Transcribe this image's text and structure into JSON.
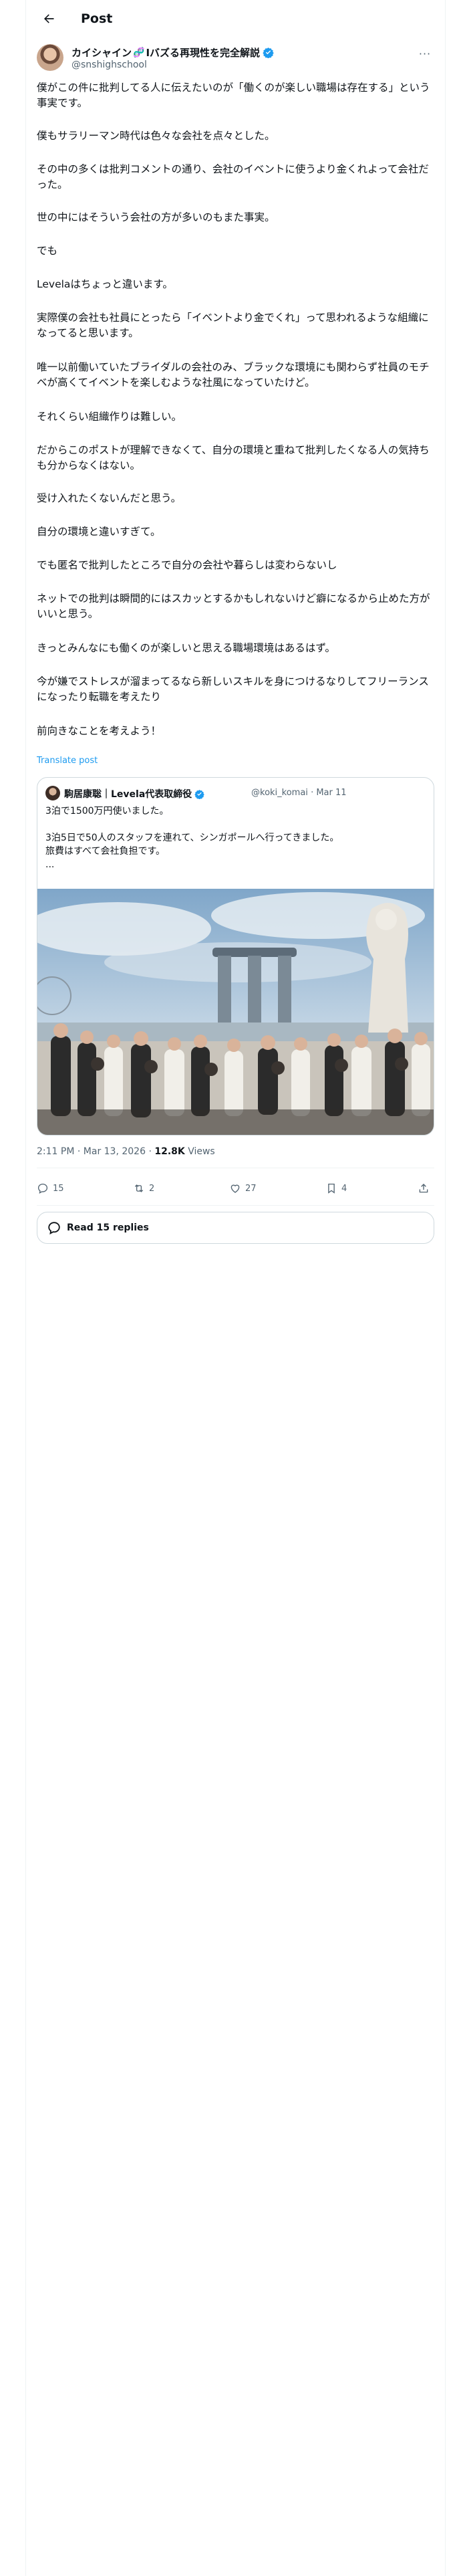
{
  "header": {
    "title": "Post"
  },
  "author": {
    "name_part1": "カイシャイン",
    "name_emoji": "🧬",
    "name_part2": "Iバズる再現性を完全解説",
    "handle": "@snshighschool",
    "more_label": "···"
  },
  "post": {
    "paragraphs": [
      "僕がこの件に批判してる人に伝えたいのが「働くのが楽しい職場は存在する」という事実です。",
      "僕もサラリーマン時代は色々な会社を点々とした。",
      "その中の多くは批判コメントの通り、会社のイベントに使うより金くれよって会社だった。",
      "世の中にはそういう会社の方が多いのもまた事実。",
      "でも",
      "Levelaはちょっと違います。",
      "実際僕の会社も社員にとったら「イベントより金でくれ」って思われるような組織になってると思います。",
      "唯一以前働いていたブライダルの会社のみ、ブラックな環境にも関わらず社員のモチベが高くてイベントを楽しむような社風になっていたけど。",
      "それくらい組織作りは難しい。",
      "だからこのポストが理解できなくて、自分の環境と重ねて批判したくなる人の気持ちも分からなくはない。",
      "受け入れたくないんだと思う。",
      "自分の環境と違いすぎて。",
      "でも匿名で批判したところで自分の会社や暮らしは変わらないし",
      "ネットでの批判は瞬間的にはスカッとするかもしれないけど癖になるから止めた方がいいと思う。",
      "きっとみんなにも働くのが楽しいと思える職場環境はあるはず。",
      "今が嫌でストレスが溜まってるなら新しいスキルを身につけるなりしてフリーランスになったり転職を考えたり",
      "前向きなことを考えよう！"
    ],
    "translate_label": "Translate post"
  },
  "quote": {
    "name": "駒居康聡｜Levela代表取締役",
    "handle": "@koki_komai",
    "date": "Mar 11",
    "lines": [
      "3泊で1500万円使いました。",
      "",
      "3泊5日で50人のスタッフを連れて、シンガポールへ行ってきました。",
      "旅費はすべて会社負担です。",
      "..."
    ]
  },
  "meta": {
    "time": "2:11 PM",
    "date": "Mar 13, 2026",
    "views_count": "12.8K",
    "views_label": "Views"
  },
  "actions": {
    "replies": "15",
    "reposts": "2",
    "likes": "27",
    "bookmarks": "4"
  },
  "read_replies_label": "Read 15 replies",
  "colors": {
    "accent": "#1d9bf0",
    "text": "#0f1419",
    "secondary": "#536471",
    "border": "#cfd9de"
  }
}
